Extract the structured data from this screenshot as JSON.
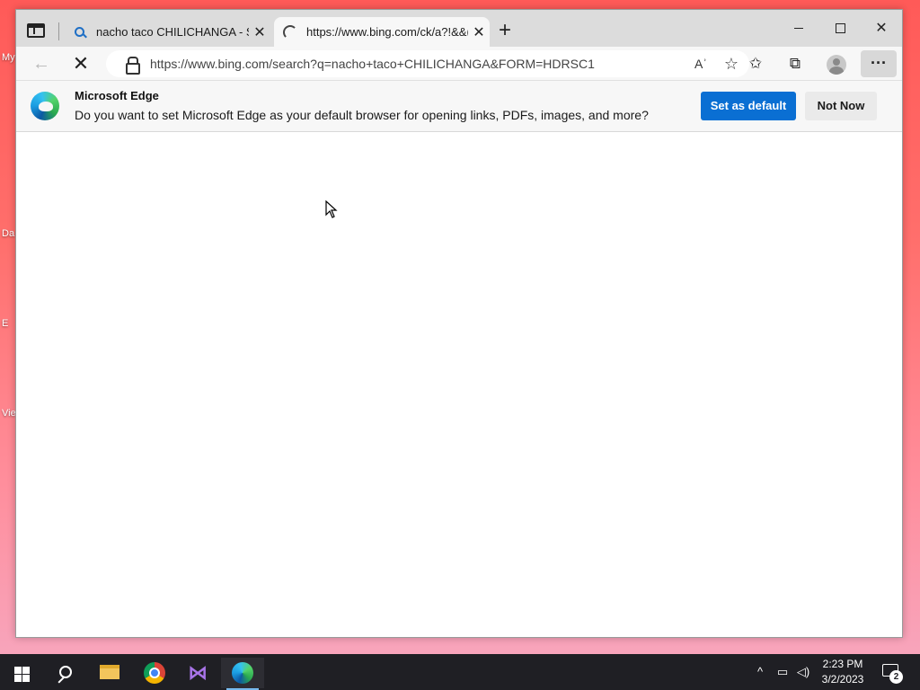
{
  "desktop": {
    "fragments": [
      "My",
      "Da",
      "E",
      "Vie"
    ]
  },
  "browser": {
    "tabs": [
      {
        "title": "nacho taco CHILICHANGA - Sear",
        "icon": "search-icon",
        "state": "inactive"
      },
      {
        "title": "https://www.bing.com/ck/a?!&&(",
        "icon": "loading-spinner-icon",
        "state": "active-loading"
      }
    ],
    "new_tab_label": "+",
    "window_controls": {
      "minimize": "—",
      "maximize": "☐",
      "close": "✕"
    },
    "address_bar": {
      "url": "https://www.bing.com/search?q=nacho+taco+CHILICHANGA&FORM=HDRSC1",
      "read_aloud_label": "Aʾ"
    },
    "more_label": "···"
  },
  "infobar": {
    "title": "Microsoft Edge",
    "message": "Do you want to set Microsoft Edge as your default browser for opening links, PDFs, images, and more?",
    "primary_button": "Set as default",
    "secondary_button": "Not Now"
  },
  "taskbar": {
    "apps": [
      "start-icon",
      "search-icon",
      "file-explorer-icon",
      "chrome-icon",
      "visual-studio-icon",
      "edge-icon"
    ],
    "active_app": "edge-icon",
    "time": "2:23 PM",
    "date": "3/2/2023",
    "notification_count": "2",
    "accent_color": "#76b9ed"
  },
  "colors": {
    "primary_button": "#0a6fd3",
    "wallpaper_top": "#ff5a58",
    "wallpaper_bottom": "#f6a9c2"
  }
}
